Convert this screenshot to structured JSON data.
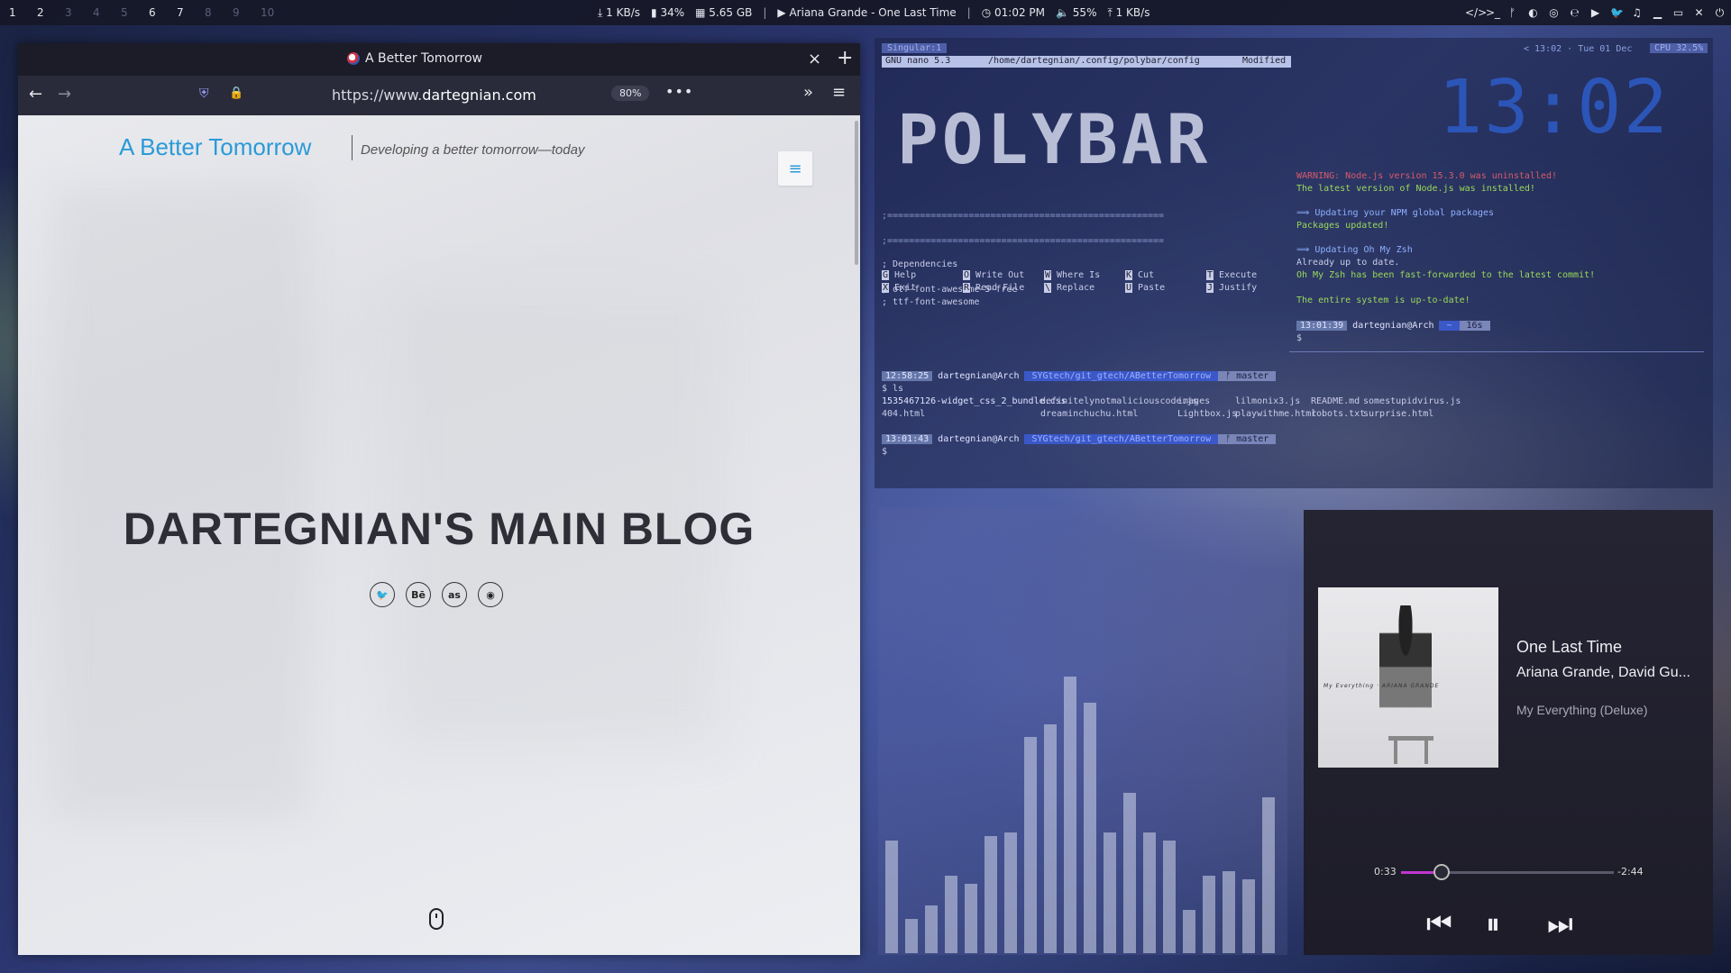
{
  "topbar": {
    "workspaces": [
      {
        "label": "1",
        "active": true
      },
      {
        "label": "2",
        "active": true
      },
      {
        "label": "3",
        "active": false
      },
      {
        "label": "4",
        "active": false
      },
      {
        "label": "5",
        "active": false
      },
      {
        "label": "6",
        "active": true
      },
      {
        "label": "7",
        "active": true
      },
      {
        "label": "8",
        "active": false
      },
      {
        "label": "9",
        "active": false
      },
      {
        "label": "10",
        "active": false
      }
    ],
    "net_down": "1 KB/s",
    "battery": "34%",
    "memory": "5.65 GB",
    "sep": "|",
    "now_playing": "Ariana Grande - One Last Time",
    "time": "01:02 PM",
    "volume": "55%",
    "net_up": "1 KB/s",
    "right_icons": [
      "code-icon",
      "terminal-icon",
      "git-icon",
      "firefox-icon",
      "chrome-icon",
      "edge-icon",
      "youtube-icon",
      "twitter-icon",
      "headphones-icon",
      "minimize-icon",
      "maximize-icon",
      "close-icon",
      "power-icon"
    ]
  },
  "browser": {
    "tab_title": "A Better Tomorrow",
    "tab_close": "×",
    "tab_new": "+",
    "back": "←",
    "forward": "→",
    "url_prefix": "https://www.",
    "url_domain": "dartegnian.com",
    "zoom": "80%",
    "page_actions": "•••",
    "overflow": "»",
    "menu": "≡",
    "page": {
      "site_title": "A Better Tomorrow",
      "site_tagline": "Developing a better tomorrow—today",
      "menu_icon": "≡",
      "blog_title": "DARTEGNIAN'S MAIN BLOG",
      "socials": [
        {
          "name": "twitter",
          "glyph": "🐦"
        },
        {
          "name": "behance",
          "glyph": "Bē"
        },
        {
          "name": "lastfm",
          "glyph": "as"
        },
        {
          "name": "github",
          "glyph": "◉"
        }
      ]
    }
  },
  "terminal": {
    "singular": "Singular:1",
    "nano_version": "GNU nano 5.3",
    "nano_path": "/home/dartegnian/.config/polybar/config",
    "nano_modified": "Modified",
    "polybar_art": "POLYBAR",
    "clock_art": "13:02",
    "top_time": "< 13:02 · Tue 01 Dec",
    "cpu": "CPU 32.5%",
    "rule": ";===================================================",
    "dependencies": "; Dependencies",
    "dep1": "; otf-font-awesome-5-free",
    "dep2": "; ttf-font-awesome",
    "shortcuts": [
      {
        "key": "^G",
        "label": "Help",
        "key2": "^X",
        "label2": "Exit"
      },
      {
        "key": "^O",
        "label": "Write Out",
        "key2": "^R",
        "label2": "Read File"
      },
      {
        "key": "^W",
        "label": "Where Is",
        "key2": "^\\",
        "label2": "Replace"
      },
      {
        "key": "^K",
        "label": "Cut",
        "key2": "^U",
        "label2": "Paste"
      },
      {
        "key": "^T",
        "label": "Execute",
        "key2": "^J",
        "label2": "Justify"
      }
    ],
    "warn": "WARNING: Node.js version 15.3.0 was uninstalled!",
    "node_ok": "The latest version of Node.js was installed!",
    "npm_upd": "⟹ Updating your NPM global packages",
    "npm_done": "Packages updated!",
    "zsh_upd": "⟹ Updating Oh My Zsh",
    "zsh_uptodate": "Already up to date.",
    "zsh_ff": "Oh My Zsh has been fast-forwarded to the latest commit!",
    "sys_ok": "The entire system is up-to-date!",
    "prompt1_time": "13:01:39",
    "prompt_user": "dartegnian@Arch",
    "prompt1_dur": "16s",
    "prompt_dollar": "$",
    "prompt2_time": "12:58:25",
    "prompt_path": "SYGtech/git_gtech/ABetterTomorrow",
    "prompt_branch": "ᚠ master",
    "cmd_ls": "$ ls",
    "ls_row1": [
      "1535467126-widget_css_2_bundle.css",
      "definitelynotmaliciouscode.js",
      "images",
      "lilmonix3.js",
      "README.md",
      "somestupidvirus.js"
    ],
    "ls_row2": [
      "404.html",
      "dreaminchuchu.html",
      "Lightbox.js",
      "playwithme.html",
      "robots.txt",
      "surprise.html"
    ],
    "prompt3_time": "13:01:43"
  },
  "visualizer": {
    "bars": [
      0.26,
      0.08,
      0.11,
      0.18,
      0.16,
      0.27,
      0.28,
      0.5,
      0.53,
      0.64,
      0.58,
      0.28,
      0.37,
      0.28,
      0.26,
      0.1,
      0.18,
      0.19,
      0.17,
      0.36
    ]
  },
  "player": {
    "album_caption": "My Everything · ARIANA GRANDE",
    "title": "One Last Time",
    "artist": "Ariana Grande, David Gu...",
    "album": "My Everything (Deluxe)",
    "time_current": "0:33",
    "time_remaining": "-2:44",
    "progress": 0.19,
    "prev": "⏮",
    "pause": "⏸",
    "next": "⏭"
  }
}
